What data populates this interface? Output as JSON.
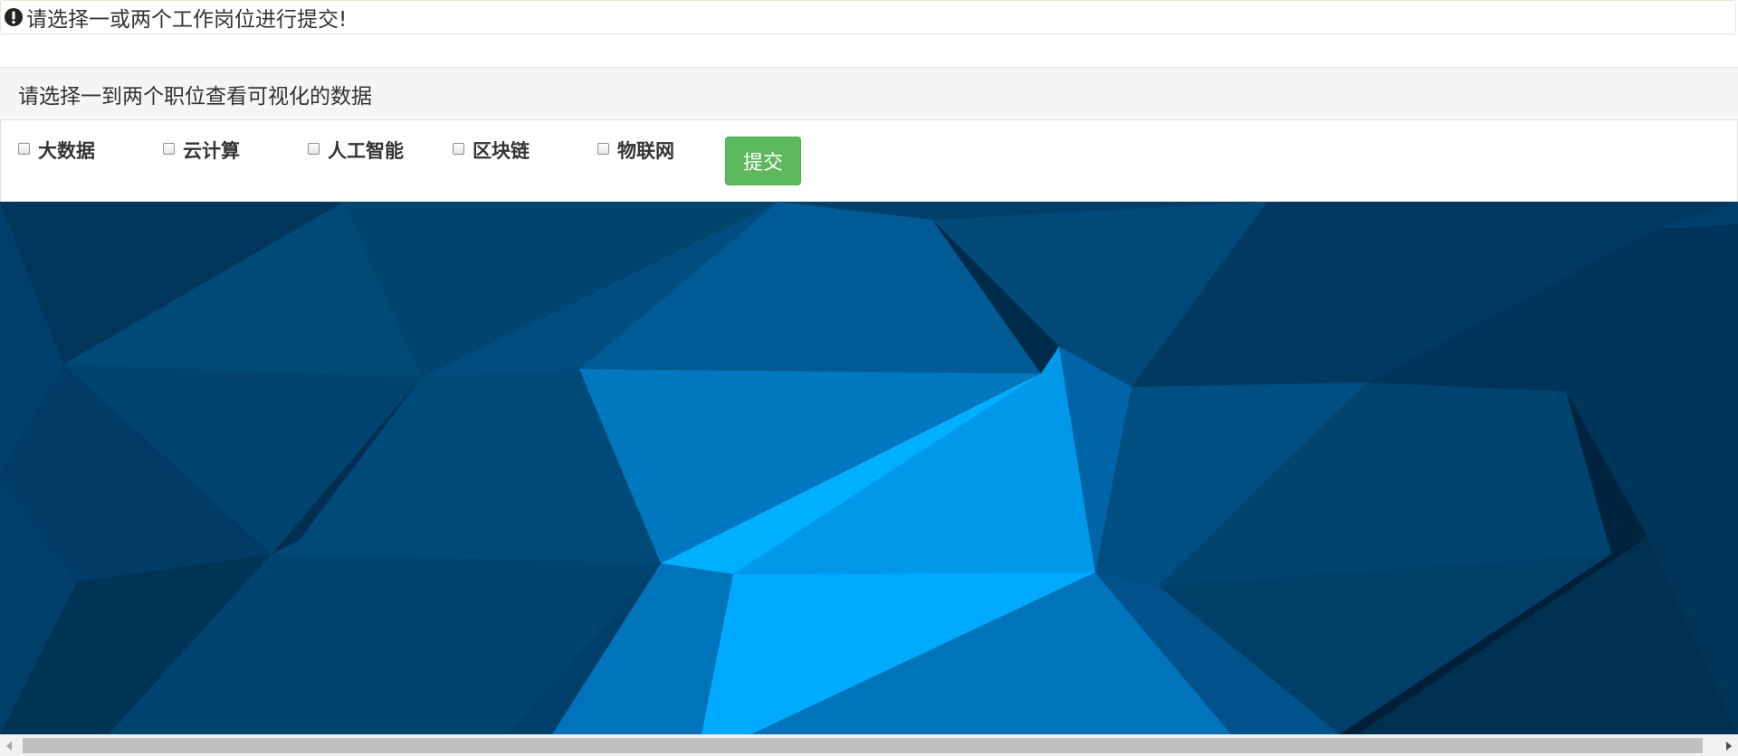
{
  "alert": {
    "icon": "exclamation-circle-icon",
    "message": "请选择一或两个工作岗位进行提交!"
  },
  "panel": {
    "heading": "请选择一到两个职位查看可视化的数据"
  },
  "options": [
    {
      "label": "大数据",
      "checked": false
    },
    {
      "label": "云计算",
      "checked": false
    },
    {
      "label": "人工智能",
      "checked": false
    },
    {
      "label": "区块链",
      "checked": false
    },
    {
      "label": "物联网",
      "checked": false
    }
  ],
  "submit": {
    "label": "提交",
    "color": "#5cb85c"
  },
  "background": {
    "description_icon": "low-poly-background",
    "accent": "#0099e6"
  }
}
